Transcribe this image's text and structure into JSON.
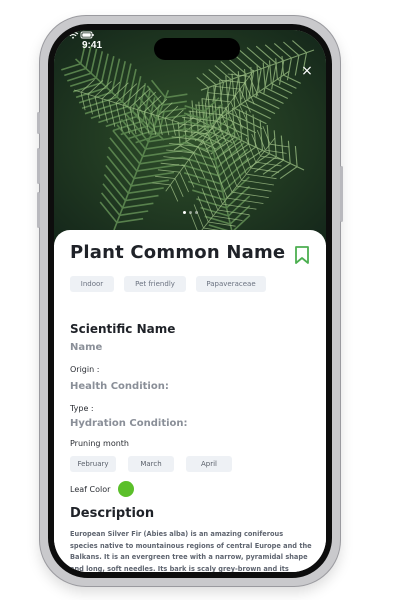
{
  "status_bar": {
    "time": "9:41"
  },
  "hero": {
    "close_label": "×",
    "page_dots": 3,
    "active_dot": 1
  },
  "plant": {
    "common_name": "Plant Common Name",
    "tags": [
      "Indoor",
      "Pet friendly",
      "Papaveraceae"
    ],
    "scientific_heading": "Scientific Name",
    "scientific_name": "Name",
    "origin_label": "Origin :",
    "health_label": "Health Condition:",
    "type_label": "Type :",
    "hydration_label": "Hydration Condition:",
    "pruning_label": "Pruning month",
    "pruning_months": [
      "February",
      "March",
      "April"
    ],
    "leaf_color_label": "Leaf Color",
    "leaf_color": "#5bbf2a",
    "description_heading": "Description",
    "description": "European Silver Fir (Abies alba) is an amazing coniferous species native to mountainous regions of central Europe and the Balkans. It is an evergreen tree with a narrow, pyramidal shape and long, soft needles. Its bark is scaly grey-brown and its branches are highly ornamental due to its conical-shaped silver-"
  },
  "colors": {
    "accent_green": "#4caf50",
    "chip_bg": "#eef1f5",
    "title_text": "#1f2228",
    "muted_text": "#8a8f98"
  }
}
